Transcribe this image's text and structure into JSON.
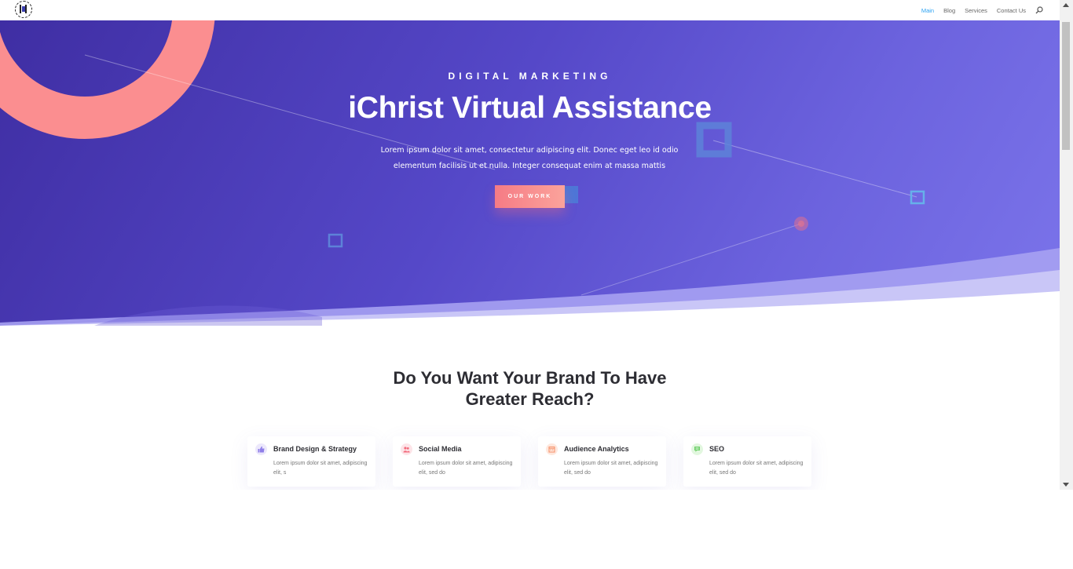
{
  "nav": {
    "items": [
      {
        "label": "Main",
        "active": true
      },
      {
        "label": "Blog",
        "active": false
      },
      {
        "label": "Services",
        "active": false
      },
      {
        "label": "Contact Us",
        "active": false
      }
    ],
    "search_icon": "search-icon"
  },
  "hero": {
    "eyebrow": "DIGITAL MARKETING",
    "title": "iChrist Virtual Assistance",
    "text": "Lorem ipsum dolor sit amet, consectetur adipiscing elit. Donec eget leo id odio elementum facilisis ut et nulla. Integer consequat enim at massa mattis",
    "button": "OUR WORK"
  },
  "section": {
    "title_line1": "Do You Want Your Brand To Have",
    "title_line2": "Greater Reach?"
  },
  "cards": [
    {
      "title": "Brand Design & Strategy",
      "desc": "Lorem ipsum dolor sit amet, adipiscing elit, s",
      "icon": "thumbs-up-icon",
      "color": "#8f7ee8"
    },
    {
      "title": "Social Media",
      "desc": "Lorem ipsum dolor sit amet, adipiscing elit, sed do",
      "icon": "users-icon",
      "color": "#f26b7c"
    },
    {
      "title": "Audience Analytics",
      "desc": "Lorem ipsum dolor sit amet, adipiscing elit, sed do",
      "icon": "calendar-icon",
      "color": "#f7956f"
    },
    {
      "title": "SEO",
      "desc": "Lorem ipsum dolor sit amet, adipiscing elit, sed do",
      "icon": "chat-icon",
      "color": "#6fd06a"
    }
  ],
  "colors": {
    "accent_nav": "#2ea3f2",
    "hero_start": "#3f2ea3",
    "hero_end": "#7b74ea",
    "coral": "#fb8e90",
    "button_start": "#f57b85"
  }
}
